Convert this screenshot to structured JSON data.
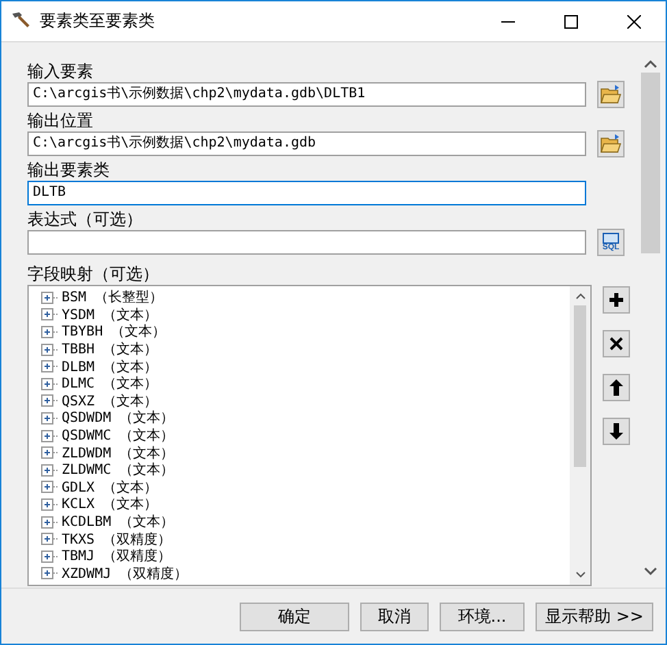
{
  "window": {
    "title": "要素类至要素类"
  },
  "fields": [
    {
      "label": "输入要素",
      "value": "C:\\arcgis书\\示例数据\\chp2\\mydata.gdb\\DLTB1",
      "focused": false,
      "kind": "browse"
    },
    {
      "label": "输出位置",
      "value": "C:\\arcgis书\\示例数据\\chp2\\mydata.gdb",
      "focused": false,
      "kind": "browse"
    },
    {
      "label": "输出要素类",
      "value": "DLTB",
      "focused": true,
      "kind": "text"
    },
    {
      "label": "表达式（可选）",
      "focused": false,
      "kind": "query",
      "button_label": "SQL"
    }
  ],
  "field_map": {
    "label": "字段映射（可选）",
    "items": [
      {
        "name": "BSM",
        "type": "（长整型）"
      },
      {
        "name": "YSDM",
        "type": "（文本）"
      },
      {
        "name": "TBYBH",
        "type": "（文本）"
      },
      {
        "name": "TBBH",
        "type": "（文本）"
      },
      {
        "name": "DLBM",
        "type": "（文本）"
      },
      {
        "name": "DLMC",
        "type": "（文本）"
      },
      {
        "name": "QSXZ",
        "type": "（文本）"
      },
      {
        "name": "QSDWDM",
        "type": "（文本）"
      },
      {
        "name": "QSDWMC",
        "type": "（文本）"
      },
      {
        "name": "ZLDWDM",
        "type": "（文本）"
      },
      {
        "name": "ZLDWMC",
        "type": "（文本）"
      },
      {
        "name": "GDLX",
        "type": "（文本）"
      },
      {
        "name": "KCLX",
        "type": "（文本）"
      },
      {
        "name": "KCDLBM",
        "type": "（文本）"
      },
      {
        "name": "TKXS",
        "type": "（双精度）"
      },
      {
        "name": "TBMJ",
        "type": "（双精度）"
      },
      {
        "name": "XZDWMJ",
        "type": "（双精度）"
      }
    ]
  },
  "buttons": [
    "确定",
    "取消",
    "环境...",
    "显示帮助 >>"
  ]
}
